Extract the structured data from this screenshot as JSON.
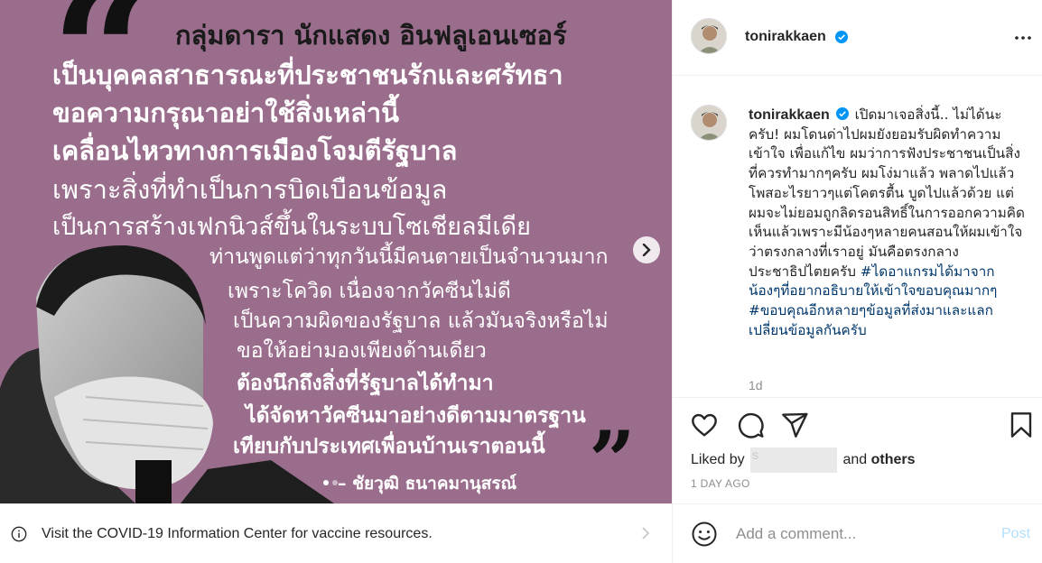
{
  "media": {
    "background": "#9b6d8d",
    "quote_open": "“",
    "quote_close": "”",
    "lines": [
      "กลุ่มดารา นักแสดง อินฟลูเอนเซอร์",
      "เป็นบุคคลสาธารณะที่ประชาชนรักและศรัทธา",
      "ขอความกรุณาอย่าใช้สิ่งเหล่านี้",
      "เคลื่อนไหวทางการเมืองโจมตีรัฐบาล",
      "เพราะสิ่งที่ทำเป็นการบิดเบือนข้อมูล",
      "เป็นการสร้างเฟกนิวส์ขึ้นในระบบโซเชียลมีเดีย",
      "ท่านพูดแต่ว่าทุกวันนี้มีคนตายเป็นจำนวนมาก",
      "เพราะโควิด เนื่องจากวัคซีนไม่ดี",
      "เป็นความผิดของรัฐบาล แล้วมันจริงหรือไม่",
      "ขอให้อย่ามองเพียงด้านเดียว",
      "ต้องนึกถึงสิ่งที่รัฐบาลได้ทำมา",
      "ได้จัดหาวัคซีนมาอย่างดีตามมาตรฐาน",
      "เทียบกับประเทศเพื่อนบ้านเราตอนนี้"
    ],
    "attribution": "– ชัยวุฒิ ธนาคมานุสรณ์",
    "next_icon": "chevron-right-icon"
  },
  "info_banner": {
    "icon": "info-icon",
    "text": "Visit the COVID-19 Information Center for vaccine resources.",
    "chevron_icon": "chevron-right-icon"
  },
  "header": {
    "username": "tonirakkaen",
    "verified_icon": "verified-badge-icon",
    "more_icon": "more-options-icon"
  },
  "caption": {
    "username": "tonirakkaen",
    "text": "เปิดมาเจอสิ่งนี้.. ไม่ได้นะครับ! ผมโดนด่าไปผมยังยอมรับผิดทำความเข้าใจ เพื่อแก้ไข ผมว่าการฟังประชาชนเป็นสิ่งที่ควรทำมากๆครับ ผมโง่มาแล้ว พลาดไปแล้ว โพสอะไรยาวๆแต่โคตรตื้น บูดไปแล้วด้วย แต่ผมจะไม่ยอมถูกลิดรอนสิทธิ์ในการออกความคิดเห็นแล้วเพราะมีน้องๆหลายคนสอนให้ผมเข้าใจว่าตรงกลางที่เราอยู่ มันคือตรงกลางประชาธิปไตยครับ",
    "hashtag1": "#ไดอาแกรมได้มาจากน้องๆที่อยากอธิบายให้เข้าใจขอบคุณมากๆ",
    "hashtag2": "#ขอบคุณอีกหลายๆข้อมูลที่ส่งมาและแลกเปลี่ยนข้อมูลกันครับ",
    "time": "1d"
  },
  "actions": {
    "like_icon": "heart-icon",
    "comment_icon": "comment-icon",
    "share_icon": "share-icon",
    "save_icon": "bookmark-icon",
    "liked_by_prefix": "Liked by",
    "liked_by_user": "s",
    "liked_by_and": "and",
    "liked_by_others": "others",
    "posted_ago": "1 DAY AGO"
  },
  "comment": {
    "emoji_icon": "smiley-icon",
    "placeholder": "Add a comment...",
    "post_label": "Post"
  },
  "colors": {
    "link": "#00376b",
    "post_disabled": "#b2dffc",
    "verified": "#0095f6",
    "muted": "#8e8e8e"
  }
}
